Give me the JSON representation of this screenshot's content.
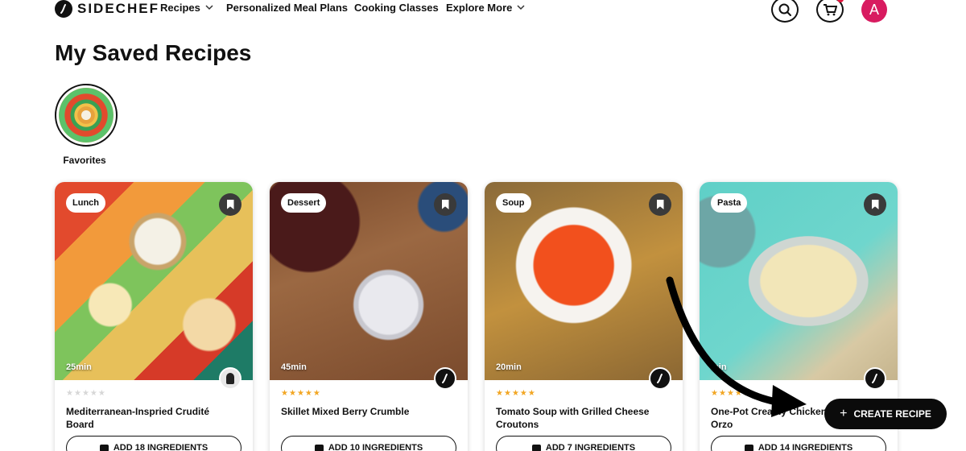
{
  "nav": {
    "logo_text": "SIDECHEF",
    "items": [
      {
        "label": "Recipes",
        "has_dropdown": true
      },
      {
        "label": "Personalized Meal Plans",
        "has_dropdown": false
      },
      {
        "label": "Cooking Classes",
        "has_dropdown": false
      },
      {
        "label": "Explore More",
        "has_dropdown": true
      }
    ],
    "icons": {
      "search": "search-icon",
      "cart": "cart-icon"
    },
    "avatar_letter": "A",
    "cart_badge_color": "#e2163d",
    "avatar_color": "#d81b60"
  },
  "page": {
    "title": "My Saved Recipes"
  },
  "collections": [
    {
      "label": "Favorites"
    }
  ],
  "recipes": [
    {
      "tag": "Lunch",
      "time": "25min",
      "rating": 0,
      "title": "Mediterranean-Inspried Crudité Board",
      "ingredients_label": "ADD 18 INGREDIENTS",
      "author_type": "person"
    },
    {
      "tag": "Dessert",
      "time": "45min",
      "rating": 5,
      "title": "Skillet Mixed Berry Crumble",
      "ingredients_label": "ADD 10 INGREDIENTS",
      "author_type": "sidechef"
    },
    {
      "tag": "Soup",
      "time": "20min",
      "rating": 5,
      "title": "Tomato Soup with Grilled Cheese Croutons",
      "ingredients_label": "ADD 7 INGREDIENTS",
      "author_type": "sidechef"
    },
    {
      "tag": "Pasta",
      "time": "min",
      "rating": 4,
      "title": "One-Pot Creamy Chicken Spinach Orzo",
      "ingredients_label": "ADD 14 INGREDIENTS",
      "author_type": "sidechef"
    }
  ],
  "cta": {
    "label": "CREATE RECIPE",
    "icon": "plus-icon"
  },
  "colors": {
    "star_filled": "#f2a623",
    "star_empty": "#d7d7d7",
    "cta_bg": "#0b0b0b"
  }
}
